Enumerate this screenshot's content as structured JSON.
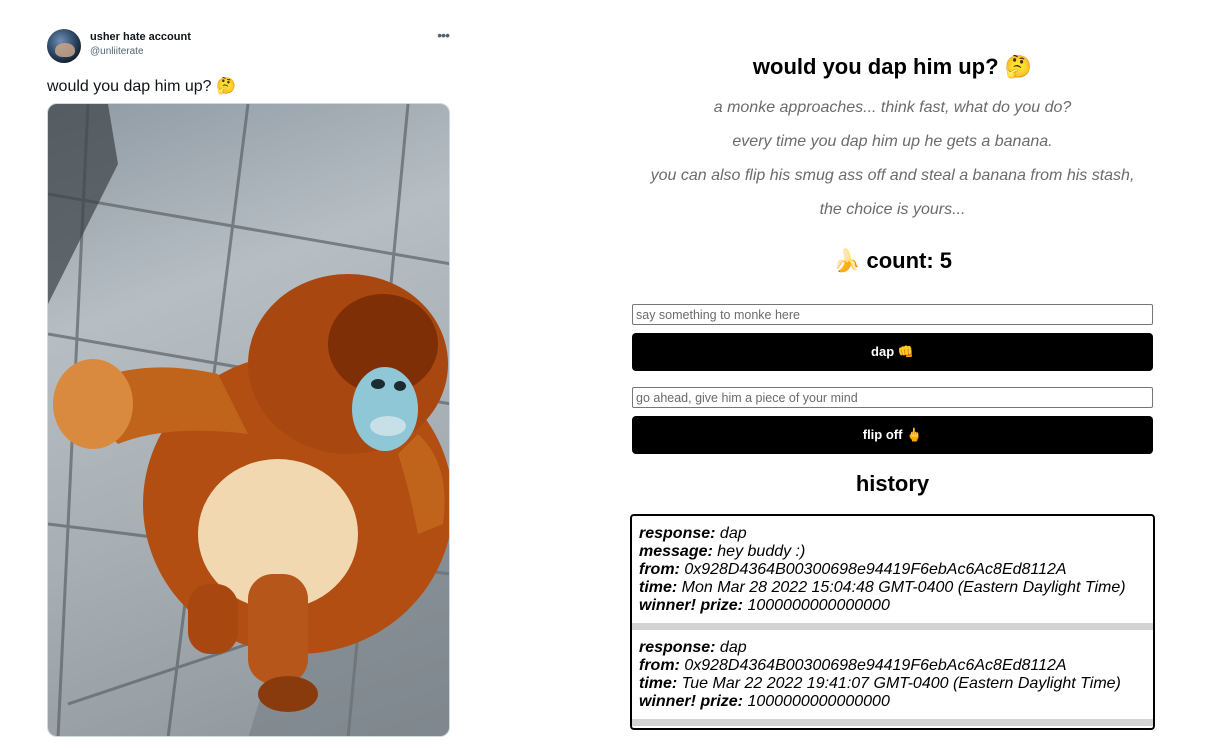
{
  "tweet": {
    "display_name": "usher hate account",
    "handle": "@unliiterate",
    "text": "would you dap him up? 🤔",
    "more_icon": "more-horizontal-icon"
  },
  "app": {
    "title": "would you dap him up? 🤔",
    "intro": [
      "a monke approaches... think fast, what do you do?",
      "every time you dap him up he gets a banana.",
      "you can also flip his smug ass off and steal a banana from his stash,",
      "the choice is yours..."
    ],
    "count_label": "🍌 count: 5",
    "dap_input_placeholder": "say something to monke here",
    "dap_button": "dap 👊",
    "flip_input_placeholder": "go ahead, give him a piece of your mind",
    "flip_button": "flip off 🖕",
    "history_title": "history",
    "history": [
      {
        "response_label": "response:",
        "response": " dap",
        "message_label": "message:",
        "message": " hey buddy :)",
        "from_label": "from:",
        "from": " 0x928D4364B00300698e94419F6ebAc6Ac8Ed8112A",
        "time_label": "time:",
        "time": " Mon Mar 28 2022 15:04:48 GMT-0400 (Eastern Daylight Time)",
        "prize_label": "winner! prize:",
        "prize": " 1000000000000000"
      },
      {
        "response_label": "response:",
        "response": " dap",
        "from_label": "from:",
        "from": " 0x928D4364B00300698e94419F6ebAc6Ac8Ed8112A",
        "time_label": "time:",
        "time": " Tue Mar 22 2022 19:41:07 GMT-0400 (Eastern Daylight Time)",
        "prize_label": "winner! prize:",
        "prize": " 1000000000000000"
      }
    ]
  }
}
